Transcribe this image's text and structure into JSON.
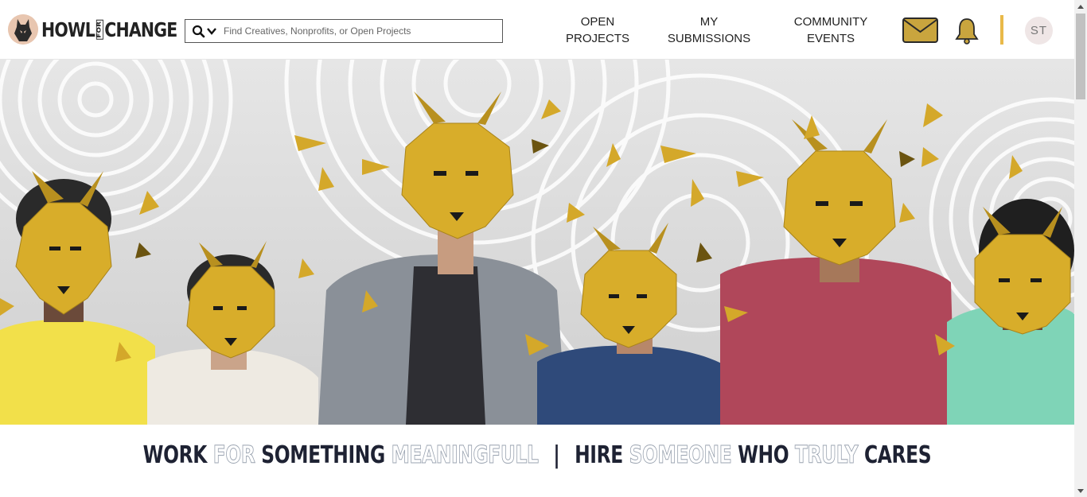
{
  "brand": {
    "logo_left": "HOWL",
    "logo_for": "FOR",
    "logo_right": "CHANGE"
  },
  "search": {
    "placeholder": "Find Creatives, Nonprofits, or Open Projects",
    "icon": "search-icon"
  },
  "nav": {
    "open_projects_line1": "OPEN",
    "open_projects_line2": "PROJECTS",
    "submissions_line1": "MY",
    "submissions_line2": "SUBMISSIONS",
    "events_line1": "COMMUNITY",
    "events_line2": "EVENTS"
  },
  "icons": {
    "mail": "mail-icon",
    "bell": "bell-icon"
  },
  "user": {
    "initials": "ST"
  },
  "tagline": {
    "p1": "WORK",
    "p2": "FOR",
    "p3": "SOMETHING",
    "p4": "MEANINGFULL",
    "separator": "|",
    "p5": "HIRE",
    "p6": "SOMEONE",
    "p7": "WHO",
    "p8": "TRULY",
    "p9": "CARES"
  },
  "colors": {
    "accent_gold": "#e9b949",
    "icon_gold": "#c9a53e",
    "tagline_dark": "#1e2233"
  }
}
